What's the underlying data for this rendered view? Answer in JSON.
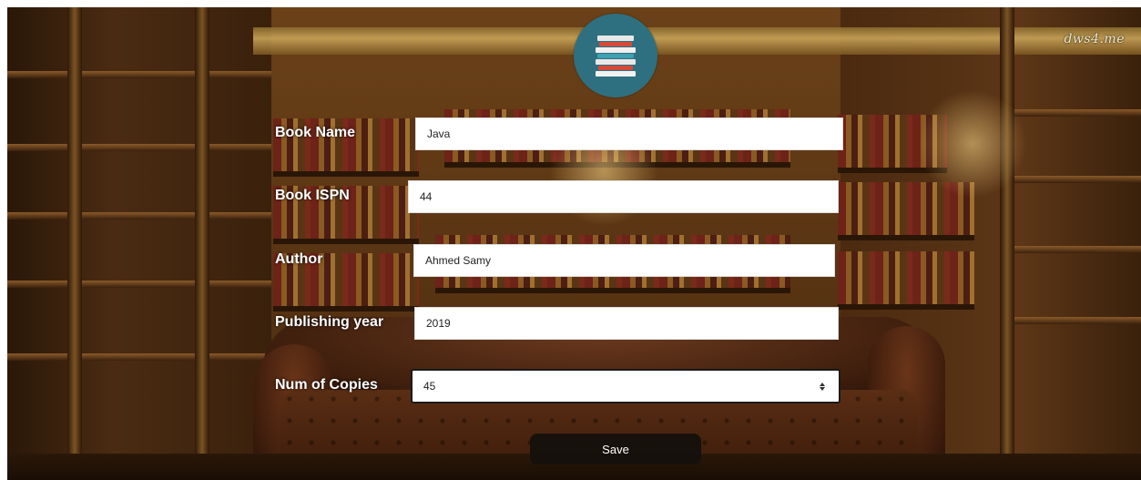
{
  "watermark": "dws4.me",
  "form": {
    "fields": [
      {
        "label": "Book Name",
        "value": "Java"
      },
      {
        "label": "Book ISPN",
        "value": "44"
      },
      {
        "label": "Author",
        "value": "Ahmed Samy"
      },
      {
        "label": "Publishing year",
        "value": "2019"
      },
      {
        "label": "Num of Copies",
        "value": "45"
      }
    ],
    "save_label": "Save"
  },
  "icons": {
    "logo": "book-stack-icon",
    "spinner": "number-spinner-icon"
  },
  "colors": {
    "logo_background": "#2f7080",
    "button_background": "#14100c",
    "label_text": "#ffffff"
  }
}
